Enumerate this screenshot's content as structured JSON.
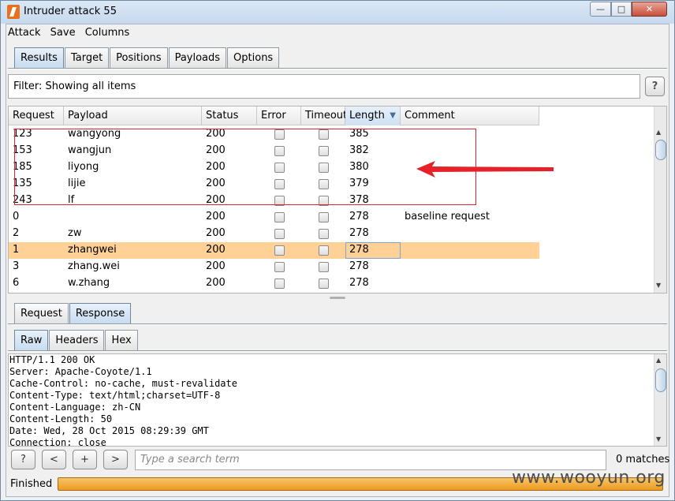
{
  "window": {
    "title": "Intruder attack 55",
    "min": "—",
    "max": "□",
    "close": "✕"
  },
  "menu": [
    "Attack",
    "Save",
    "Columns"
  ],
  "top_tabs": [
    "Results",
    "Target",
    "Positions",
    "Payloads",
    "Options"
  ],
  "filter": {
    "text": "Filter: Showing all items",
    "help": "?"
  },
  "table": {
    "columns": [
      "Request",
      "Payload",
      "Status",
      "Error",
      "Timeout",
      "Length",
      "Comment"
    ],
    "sort_indicator": "▼",
    "rows": [
      {
        "request": "123",
        "payload": "wangyong",
        "status": "200",
        "error": false,
        "timeout": false,
        "length": "385",
        "comment": ""
      },
      {
        "request": "153",
        "payload": "wangjun",
        "status": "200",
        "error": false,
        "timeout": false,
        "length": "382",
        "comment": ""
      },
      {
        "request": "185",
        "payload": "liyong",
        "status": "200",
        "error": false,
        "timeout": false,
        "length": "380",
        "comment": ""
      },
      {
        "request": "135",
        "payload": "lijie",
        "status": "200",
        "error": false,
        "timeout": false,
        "length": "379",
        "comment": ""
      },
      {
        "request": "243",
        "payload": "lf",
        "status": "200",
        "error": false,
        "timeout": false,
        "length": "378",
        "comment": ""
      },
      {
        "request": "0",
        "payload": "",
        "status": "200",
        "error": false,
        "timeout": false,
        "length": "278",
        "comment": "baseline request"
      },
      {
        "request": "2",
        "payload": "zw",
        "status": "200",
        "error": false,
        "timeout": false,
        "length": "278",
        "comment": ""
      },
      {
        "request": "1",
        "payload": "zhangwei",
        "status": "200",
        "error": false,
        "timeout": false,
        "length": "278",
        "comment": "",
        "selected": true
      },
      {
        "request": "3",
        "payload": "zhang.wei",
        "status": "200",
        "error": false,
        "timeout": false,
        "length": "278",
        "comment": ""
      },
      {
        "request": "6",
        "payload": "w.zhang",
        "status": "200",
        "error": false,
        "timeout": false,
        "length": "278",
        "comment": ""
      }
    ]
  },
  "req_tabs": [
    "Request",
    "Response"
  ],
  "view_tabs": [
    "Raw",
    "Headers",
    "Hex"
  ],
  "response_lines": [
    "HTTP/1.1 200 OK",
    "Server: Apache-Coyote/1.1",
    "Cache-Control: no-cache, must-revalidate",
    "Content-Type: text/html;charset=UTF-8",
    "Content-Language: zh-CN",
    "Content-Length: 50",
    "Date: Wed, 28 Oct 2015 08:29:39 GMT",
    "Connection: close"
  ],
  "search": {
    "placeholder": "Type a search term",
    "help": "?",
    "prev": "<",
    "add": "+",
    "next": ">",
    "matches": "0 matches"
  },
  "status": {
    "text": "Finished",
    "progress_percent": 100
  },
  "watermark": "www.wooyun.org",
  "colors": {
    "selected_row": "#ffd196",
    "annotation": "#d7262c",
    "progress": "#ec9b1e"
  }
}
